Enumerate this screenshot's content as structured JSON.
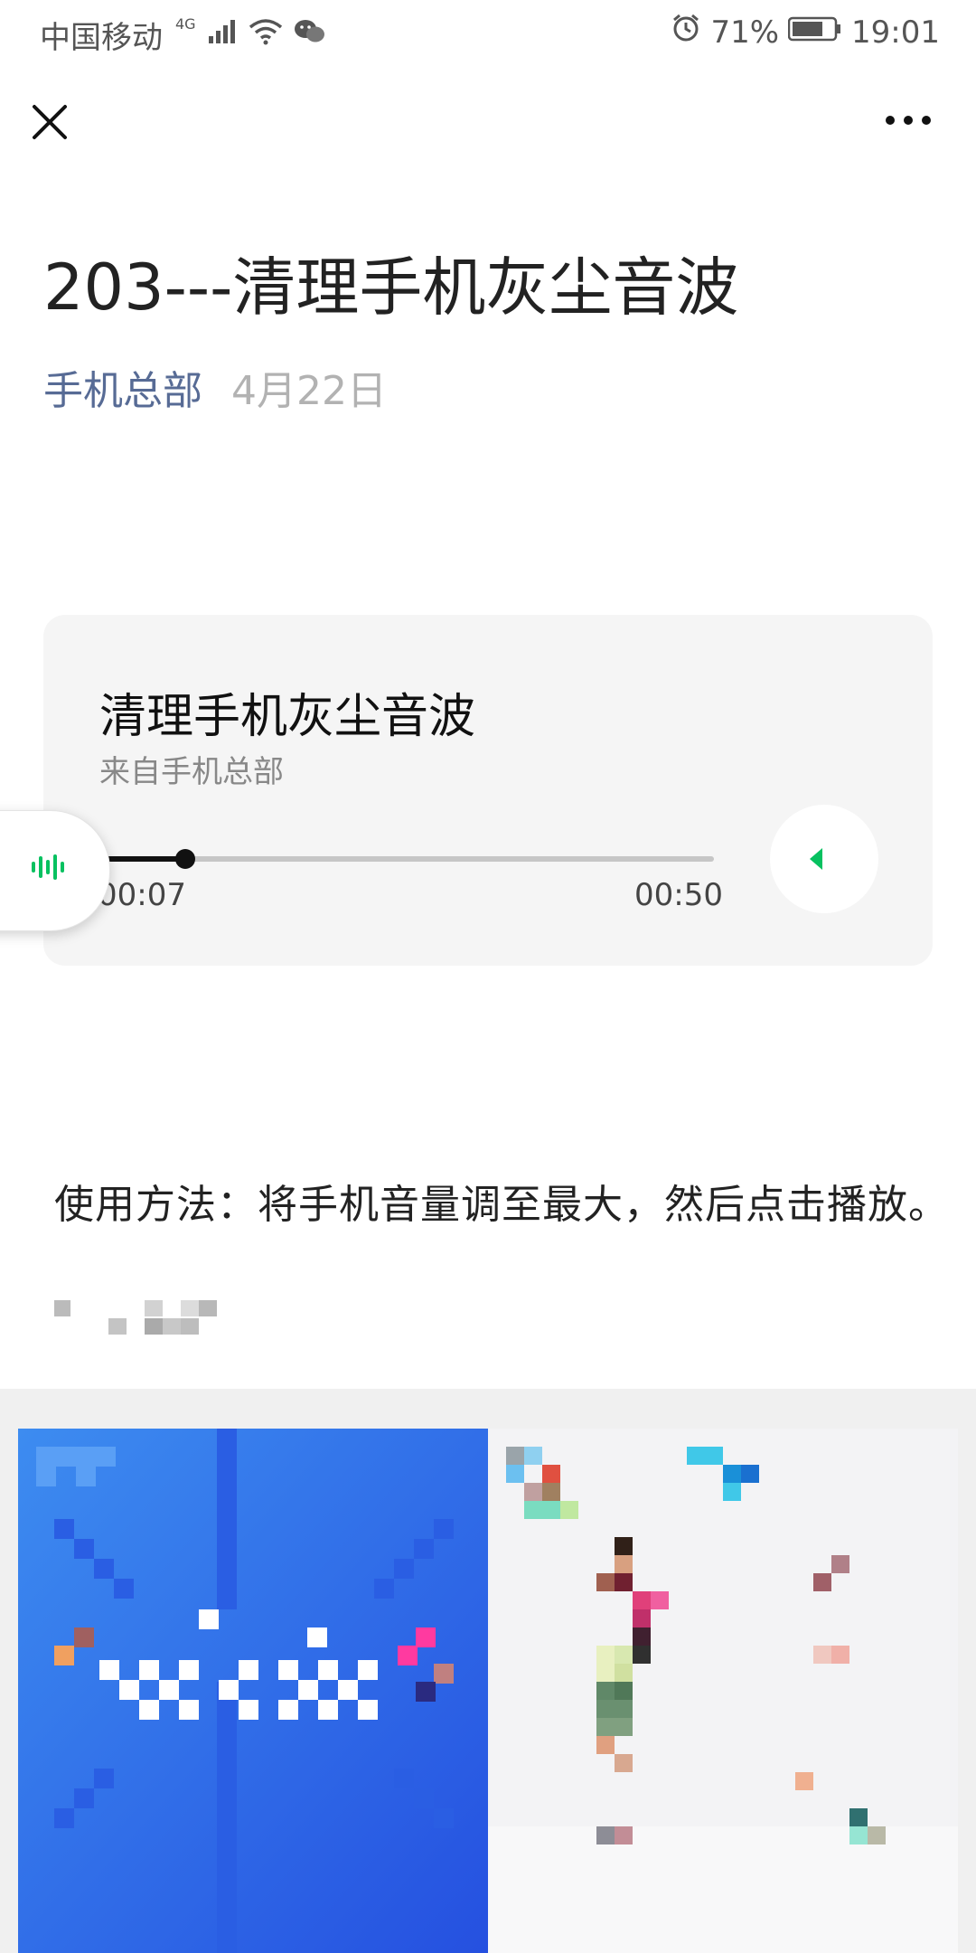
{
  "status_bar": {
    "carrier": "中国移动",
    "network": "4G",
    "battery": "71%",
    "time": "19:01"
  },
  "nav": {
    "close_icon": "close-icon",
    "more_icon": "more-icon"
  },
  "article": {
    "title": "203---清理手机灰尘音波",
    "author": "手机总部",
    "date": "4月22日"
  },
  "audio": {
    "title": "清理手机灰尘音波",
    "source": "来自手机总部",
    "current_time": "00:07",
    "duration": "00:50",
    "progress": 0.14
  },
  "body": {
    "usage": "使用方法：将手机音量调至最大，然后点击播放。"
  },
  "colors": {
    "accent": "#07c160",
    "author_link": "#576b95"
  }
}
